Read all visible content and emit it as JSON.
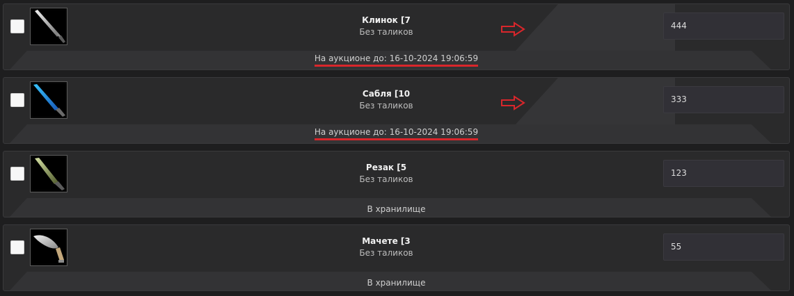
{
  "items": [
    {
      "name": "Клинок [7",
      "subtitle": "Без таликов",
      "price": "444",
      "status": "На аукционе до: 16-10-2024 19:06:59",
      "status_highlight": true,
      "arrow": true,
      "icon": "blade-icon"
    },
    {
      "name": "Сабля [10",
      "subtitle": "Без таликов",
      "price": "333",
      "status": "На аукционе до: 16-10-2024 19:06:59",
      "status_highlight": true,
      "arrow": true,
      "icon": "saber-icon"
    },
    {
      "name": "Резак [5",
      "subtitle": "Без таликов",
      "price": "123",
      "status": "В хранилище",
      "status_highlight": false,
      "arrow": false,
      "icon": "cutter-icon"
    },
    {
      "name": "Мачете [3",
      "subtitle": "Без таликов",
      "price": "55",
      "status": "В хранилище",
      "status_highlight": false,
      "arrow": false,
      "icon": "machete-icon"
    }
  ],
  "colors": {
    "background": "#1e1e1f",
    "card": "#2a2a2b",
    "highlight_underline": "#d9262b",
    "arrow": "#d9262b"
  }
}
